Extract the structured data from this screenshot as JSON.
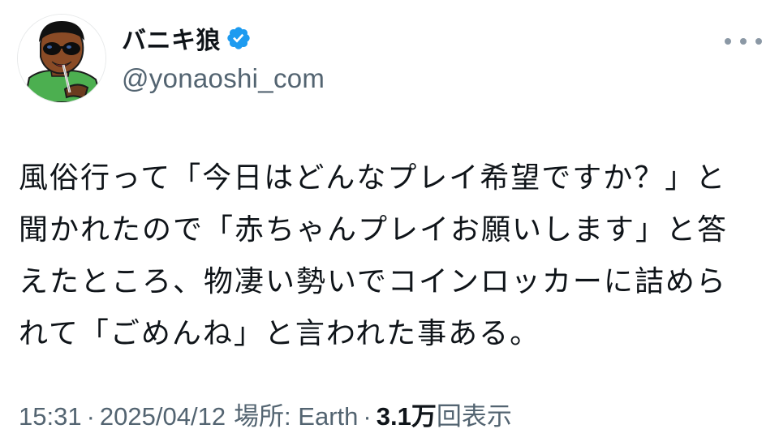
{
  "user": {
    "display_name": "バニキ狼",
    "handle": "@yonaoshi_com",
    "verified_color": "#1d9bf0"
  },
  "tweet": {
    "lines": [
      "風俗行って「今日はどんなプレイ希望ですか？」と",
      "聞かれたので「赤ちゃんプレイお願いします」と答",
      "えたところ、物凄い勢いでコインロッカーに詰めら",
      "れて「ごめんね」と言われた事ある。"
    ]
  },
  "meta": {
    "time": "15:31",
    "date": "2025/04/12",
    "location": "場所: Earth",
    "views_count": "3.1万",
    "views_label": "回表示",
    "separator": "·"
  },
  "icons": {
    "more": "more-horizontal-icon",
    "verified": "verified-badge-icon"
  }
}
